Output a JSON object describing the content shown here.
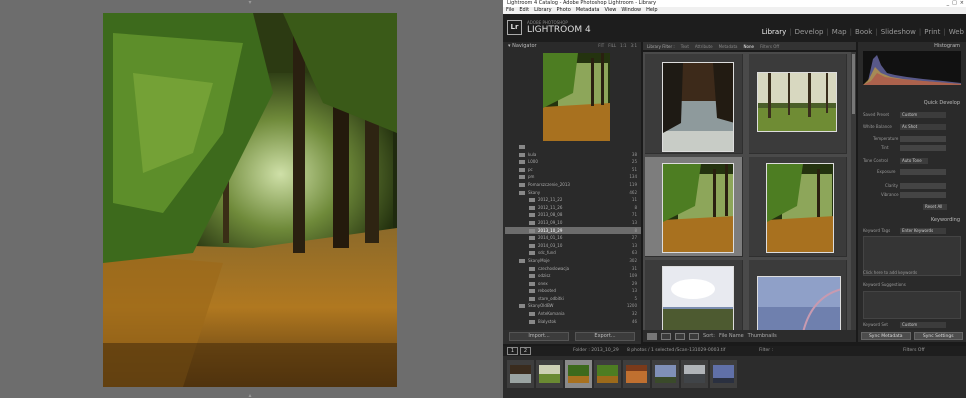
{
  "window": {
    "title": "Lightroom 4 Catalog - Adobe Photoshop Lightroom - Library",
    "controls": [
      "_",
      "□",
      "×"
    ]
  },
  "menu": [
    "File",
    "Edit",
    "Library",
    "Photo",
    "Metadata",
    "View",
    "Window",
    "Help"
  ],
  "identity": {
    "logo": "Lr",
    "adobe": "ADOBE PHOTOSHOP",
    "product": "LIGHTROOM 4"
  },
  "modules": [
    "Library",
    "Develop",
    "Map",
    "Book",
    "Slideshow",
    "Print",
    "Web"
  ],
  "active_module": "Library",
  "navigator": {
    "title": "Navigator",
    "modes": [
      "FIT",
      "FILL",
      "1:1",
      "3:1"
    ]
  },
  "folders": [
    {
      "label": "",
      "count": ""
    },
    {
      "label": "kula",
      "count": "38"
    },
    {
      "label": "L000",
      "count": "25"
    },
    {
      "label": "pc",
      "count": "51"
    },
    {
      "label": "pm",
      "count": "134"
    },
    {
      "label": "Pomarszczenie_2013",
      "count": "119"
    },
    {
      "label": "Skany",
      "count": "462"
    },
    {
      "label": "2012_11_22",
      "count": "11"
    },
    {
      "label": "2012_11_26",
      "count": "8"
    },
    {
      "label": "2013_08_08",
      "count": "71"
    },
    {
      "label": "2013_09_10",
      "count": "13"
    },
    {
      "label": "2013_10_29",
      "count": "8"
    },
    {
      "label": "2014_01_16",
      "count": "27"
    },
    {
      "label": "2014_03_10",
      "count": "13"
    },
    {
      "label": "sdc_fund",
      "count": "63"
    },
    {
      "label": "SkanyMoje",
      "count": "302"
    },
    {
      "label": "czechoslowacja",
      "count": "31"
    },
    {
      "label": "odzisz",
      "count": "109"
    },
    {
      "label": "onex",
      "count": "29"
    },
    {
      "label": "rebooted",
      "count": "13"
    },
    {
      "label": "stare_odbitki",
      "count": "5"
    },
    {
      "label": "SkanyOldBW",
      "count": "1200"
    },
    {
      "label": "AnteKomania",
      "count": "32"
    },
    {
      "label": "Bialystok",
      "count": "46"
    }
  ],
  "left_buttons": {
    "import": "Import...",
    "export": "Export..."
  },
  "filter_bar": {
    "label": "Library Filter :",
    "options": [
      "Text",
      "Attribute",
      "Metadata",
      "None"
    ],
    "active": "None",
    "filters_off": "Filters Off"
  },
  "toolbar": {
    "sort_label": "Sort:",
    "sort_value": "File Name",
    "thumbnails_label": "Thumbnails"
  },
  "right_panel": {
    "histogram": "Histogram",
    "quick_develop": "Quick Develop",
    "saved_preset_label": "Saved Preset",
    "saved_preset": "Custom",
    "white_balance_label": "White Balance",
    "white_balance": "As Shot",
    "temperature": "Temperature",
    "tint": "Tint",
    "tone_control": "Tone Control",
    "auto_tone": "Auto Tone",
    "exposure": "Exposure",
    "clarity": "Clarity",
    "vibrance": "Vibrance",
    "reset_all": "Reset All",
    "keywording": "Keywording",
    "keyword_tags_label": "Keyword Tags",
    "keyword_tags": "Enter Keywords",
    "click_to_add": "Click here to add keywords",
    "keyword_suggestions": "Keyword Suggestions",
    "keyword_set_label": "Keyword Set",
    "keyword_set": "Custom"
  },
  "sync": {
    "metadata": "Sync Metadata",
    "settings": "Sync Settings"
  },
  "filmstrip_bar": {
    "page1": "1",
    "page2": "2",
    "path": "Folder : 2013_10_29",
    "count": "8 photos / 1 selected",
    "file": "/Scan-131029-0003.tif",
    "filter_label": "Filter :",
    "filter_value": "Filters Off"
  },
  "colors": {
    "accent": "#eeeeee",
    "panel": "#2a2a2a",
    "grid": "#4a4a4a",
    "selected_cell": "#7d7d7d"
  }
}
